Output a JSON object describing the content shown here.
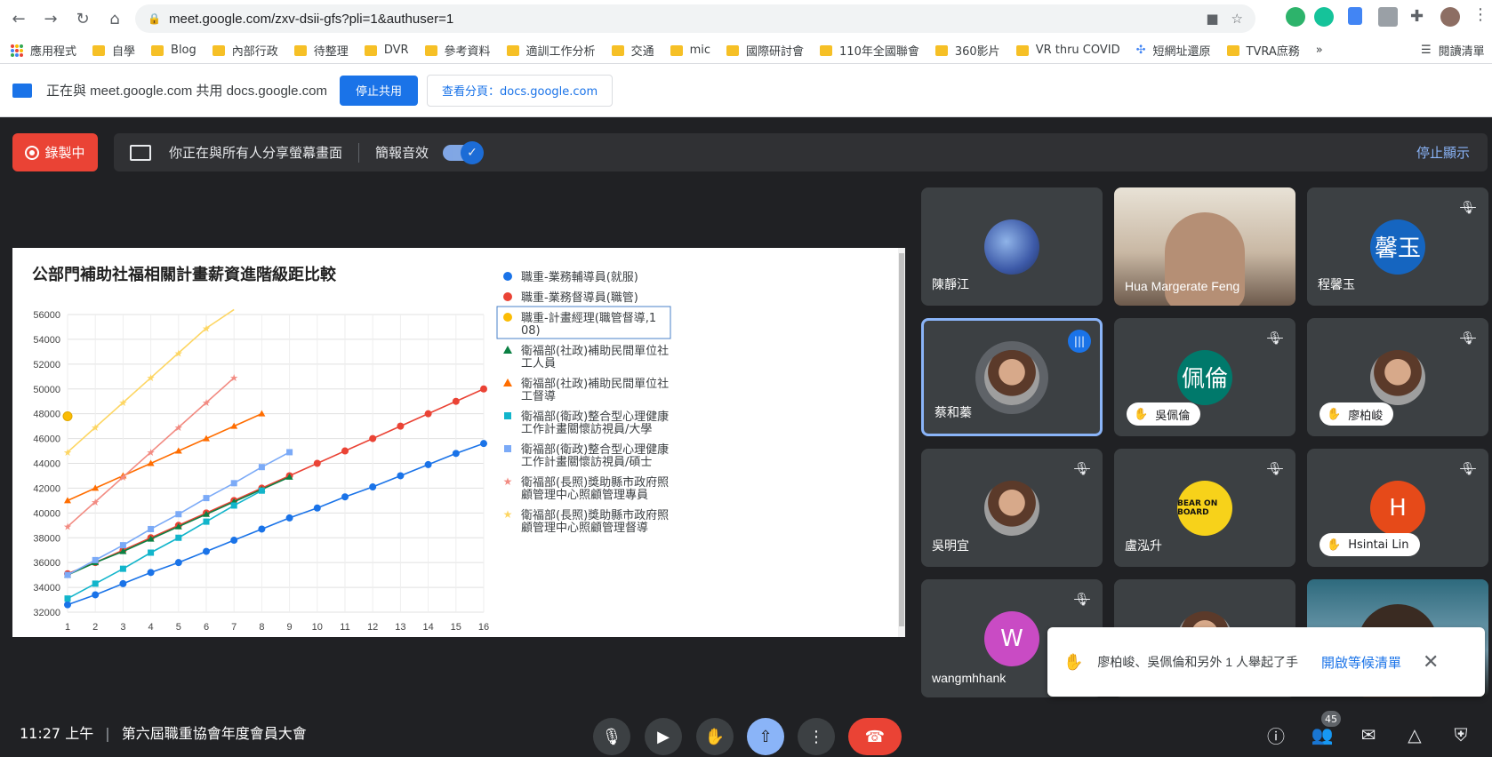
{
  "browser": {
    "url": "meet.google.com/zxv-dsii-gfs?pli=1&authuser=1",
    "bookmarks": [
      "應用程式",
      "自學",
      "Blog",
      "內部行政",
      "待整理",
      "DVR",
      "參考資料",
      "適訓工作分析",
      "交通",
      "mic",
      "國際研討會",
      "110年全國聯會",
      "360影片",
      "VR thru COVID",
      "短網址還原",
      "TVRA庶務"
    ],
    "more_bookmarks": "»",
    "reading_list": "閱讀清單"
  },
  "share_bar": {
    "text": "正在與 meet.google.com 共用 docs.google.com",
    "stop_label": "停止共用",
    "view_label": "查看分頁：docs.google.com"
  },
  "meet": {
    "recording_label": "錄製中",
    "presenting_text": "你正在與所有人分享螢幕畫面",
    "audio_label": "簡報音效",
    "stop_display": "停止顯示",
    "clock": "11:27 上午",
    "meeting_title": "第六屆職重協會年度會員大會",
    "people_count": "45",
    "raised_hands_text": "廖柏峻、吳佩倫和另外 1 人舉起了手",
    "open_queue": "開啟等候清單"
  },
  "participants": [
    {
      "name": "陳靜江",
      "avatar": "photo-flowers"
    },
    {
      "name": "Hua Margerate Feng",
      "avatar": "video"
    },
    {
      "name": "程馨玉",
      "avatar_text": "馨玉",
      "color": "#1565c0",
      "muted": true
    },
    {
      "name": "蔡和蓁",
      "avatar": "photo",
      "speaking": true
    },
    {
      "name": "吳佩倫",
      "avatar_text": "佩倫",
      "color": "#00796b",
      "muted": true,
      "hand": true
    },
    {
      "name": "廖柏峻",
      "avatar": "photo",
      "muted": true,
      "hand": true
    },
    {
      "name": "吳明宜",
      "avatar": "photo",
      "muted": true
    },
    {
      "name": "盧泓升",
      "avatar": "bear-on-board",
      "avatar_text": "BEAR ON BOARD",
      "muted": true
    },
    {
      "name": "Hsintai Lin",
      "avatar_text": "H",
      "color": "#e64a19",
      "muted": true,
      "hand": true
    },
    {
      "name": "wangmhhank",
      "avatar_text": "W",
      "color": "#c94bc4",
      "muted": true
    },
    {
      "name": "",
      "avatar": "photo"
    },
    {
      "name": "",
      "avatar": "video"
    }
  ],
  "chart_data": {
    "type": "line",
    "title": "公部門補助社福相關計畫薪資進階級距比較",
    "x": [
      1,
      2,
      3,
      4,
      5,
      6,
      7,
      8,
      9,
      10,
      11,
      12,
      13,
      14,
      15,
      16
    ],
    "ylim": [
      32000,
      56000
    ],
    "yticks": [
      32000,
      34000,
      36000,
      38000,
      40000,
      42000,
      44000,
      46000,
      48000,
      50000,
      52000,
      54000,
      56000
    ],
    "xlabel": "",
    "ylabel": "",
    "grid": true,
    "legend": "right",
    "series": [
      {
        "name": "職重-業務輔導員(就服)",
        "color": "#1a73e8",
        "marker": "circle",
        "values": [
          32600,
          33400,
          34300,
          35200,
          36000,
          36900,
          37800,
          38700,
          39600,
          40400,
          41300,
          42100,
          43000,
          43900,
          44800,
          45600
        ]
      },
      {
        "name": "職重-業務督導員(職管)",
        "color": "#ea4335",
        "marker": "circle",
        "values": [
          35100,
          36000,
          37000,
          38000,
          39000,
          40000,
          41000,
          42000,
          43000,
          44000,
          45000,
          46000,
          47000,
          48000,
          49000,
          50000
        ]
      },
      {
        "name": "職重-計畫經理(職管督導,108)",
        "color": "#fbbc04",
        "marker": "circle",
        "values": [
          47800
        ]
      },
      {
        "name": "衛福部(社政)補助民間單位社工人員",
        "color": "#0b8043",
        "marker": "triangle",
        "values": [
          35000,
          36000,
          36900,
          37900,
          38900,
          39900,
          40900,
          41900,
          42900
        ]
      },
      {
        "name": "衛福部(社政)補助民間單位社工督導",
        "color": "#ff6d00",
        "marker": "triangle",
        "values": [
          41000,
          42000,
          43000,
          44000,
          45000,
          46000,
          47000,
          48000
        ]
      },
      {
        "name": "衛福部(衛政)整合型心理健康工作計畫關懷訪視員/大學",
        "color": "#12b5cb",
        "marker": "square",
        "values": [
          33100,
          34300,
          35500,
          36800,
          38000,
          39300,
          40600,
          41800
        ]
      },
      {
        "name": "衛福部(衛政)整合型心理健康工作計畫關懷訪視員/碩士",
        "color": "#7baaf7",
        "marker": "square",
        "values": [
          35000,
          36200,
          37400,
          38700,
          39900,
          41200,
          42400,
          43700,
          44900
        ]
      },
      {
        "name": "衛福部(長照)獎助縣市政府照顧管理中心照顧管理專員",
        "color": "#f28b82",
        "marker": "star",
        "values": [
          38900,
          40900,
          42900,
          44900,
          46900,
          48900,
          50900
        ]
      },
      {
        "name": "衛福部(長照)獎助縣市政府照顧管理中心照顧管理督導",
        "color": "#fdd663",
        "marker": "star",
        "values": [
          44900,
          46900,
          48900,
          50900,
          52900,
          54900,
          56900
        ]
      }
    ]
  }
}
